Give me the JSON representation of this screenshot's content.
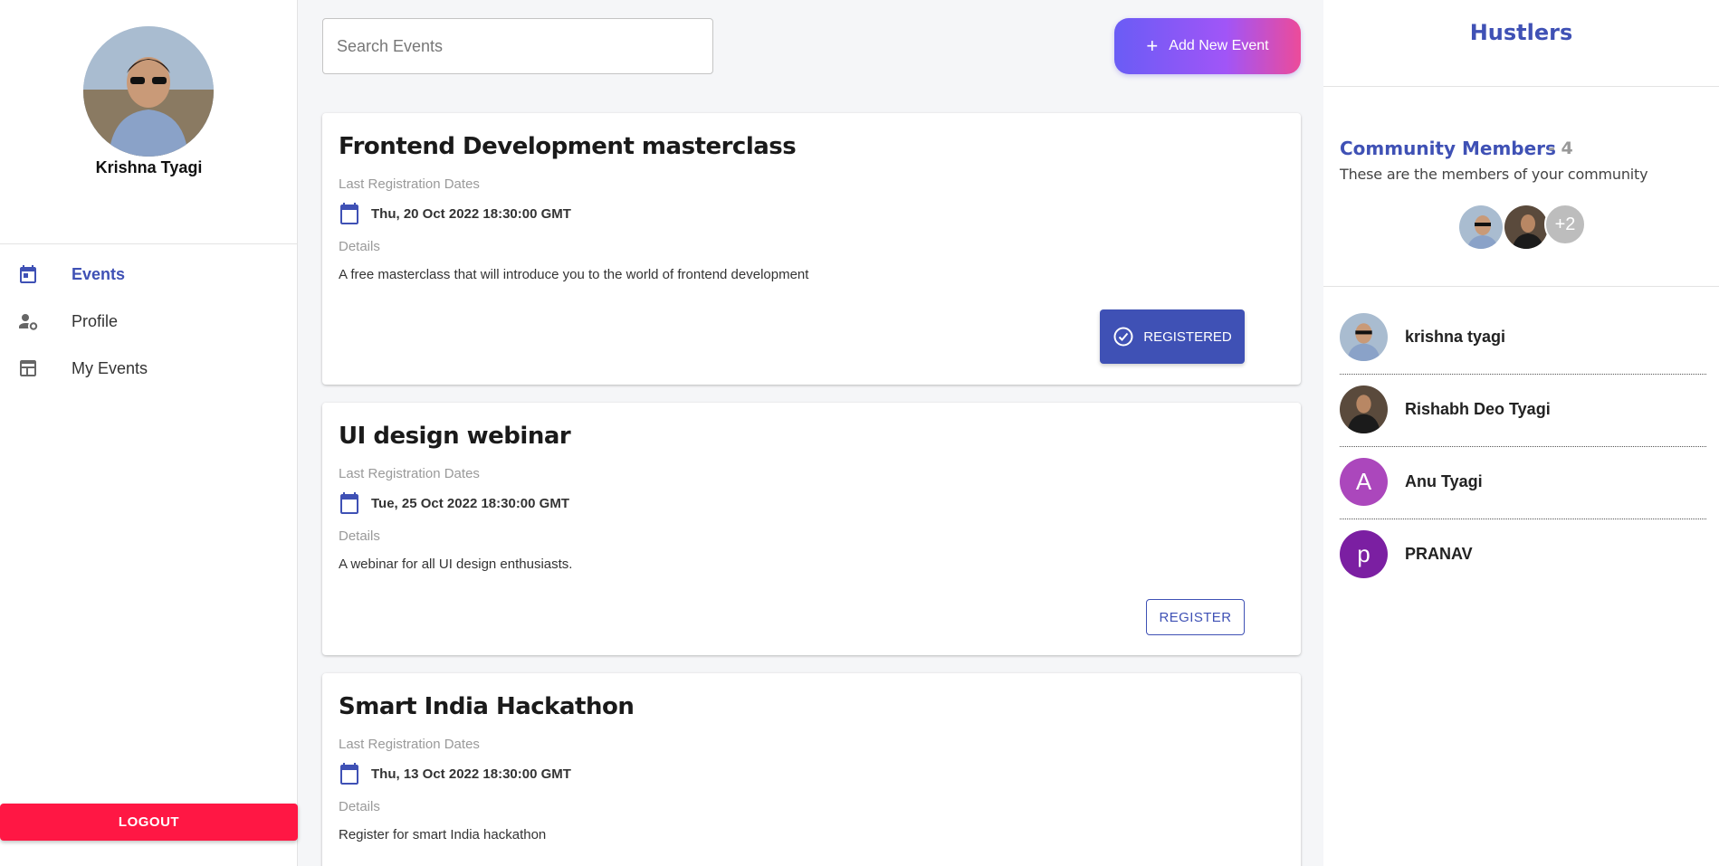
{
  "user": {
    "name": "Krishna Tyagi"
  },
  "nav": [
    {
      "label": "Events",
      "icon": "calendar-icon",
      "active": true
    },
    {
      "label": "Profile",
      "icon": "user-settings-icon",
      "active": false
    },
    {
      "label": "My Events",
      "icon": "table-calendar-icon",
      "active": false
    }
  ],
  "logout_label": "LOGOUT",
  "search": {
    "placeholder": "Search Events"
  },
  "add_event_label": "Add New Event",
  "events": [
    {
      "title": "Frontend Development masterclass",
      "date_label": "Last Registration Dates",
      "date": "Thu, 20 Oct 2022 18:30:00 GMT",
      "details_label": "Details",
      "description": "A free masterclass that will introduce you to the world of frontend development",
      "button_label": "REGISTERED",
      "registered": true
    },
    {
      "title": "UI design webinar",
      "date_label": "Last Registration Dates",
      "date": "Tue, 25 Oct 2022 18:30:00 GMT",
      "details_label": "Details",
      "description": "A webinar for all UI design enthusiasts.",
      "button_label": "REGISTER",
      "registered": false
    },
    {
      "title": "Smart India Hackathon",
      "date_label": "Last Registration Dates",
      "date": "Thu, 13 Oct 2022 18:30:00 GMT",
      "details_label": "Details",
      "description": "Register for smart India hackathon",
      "button_label": "",
      "registered": false
    }
  ],
  "community": {
    "brand": "Hustlers",
    "title": "Community Members",
    "count": "- 4",
    "subtitle": "These are the members of your community",
    "more_count": "+2",
    "members": [
      {
        "name": "krishna tyagi",
        "avatar": "photo"
      },
      {
        "name": "Rishabh Deo Tyagi",
        "avatar": "photo"
      },
      {
        "name": "Anu Tyagi",
        "avatar": "A",
        "color": "#ab47bc"
      },
      {
        "name": "PRANAV",
        "avatar": "p",
        "color": "#7b1fa2"
      }
    ]
  },
  "colors": {
    "primary": "#3f51b5",
    "logout": "#ff1744"
  }
}
